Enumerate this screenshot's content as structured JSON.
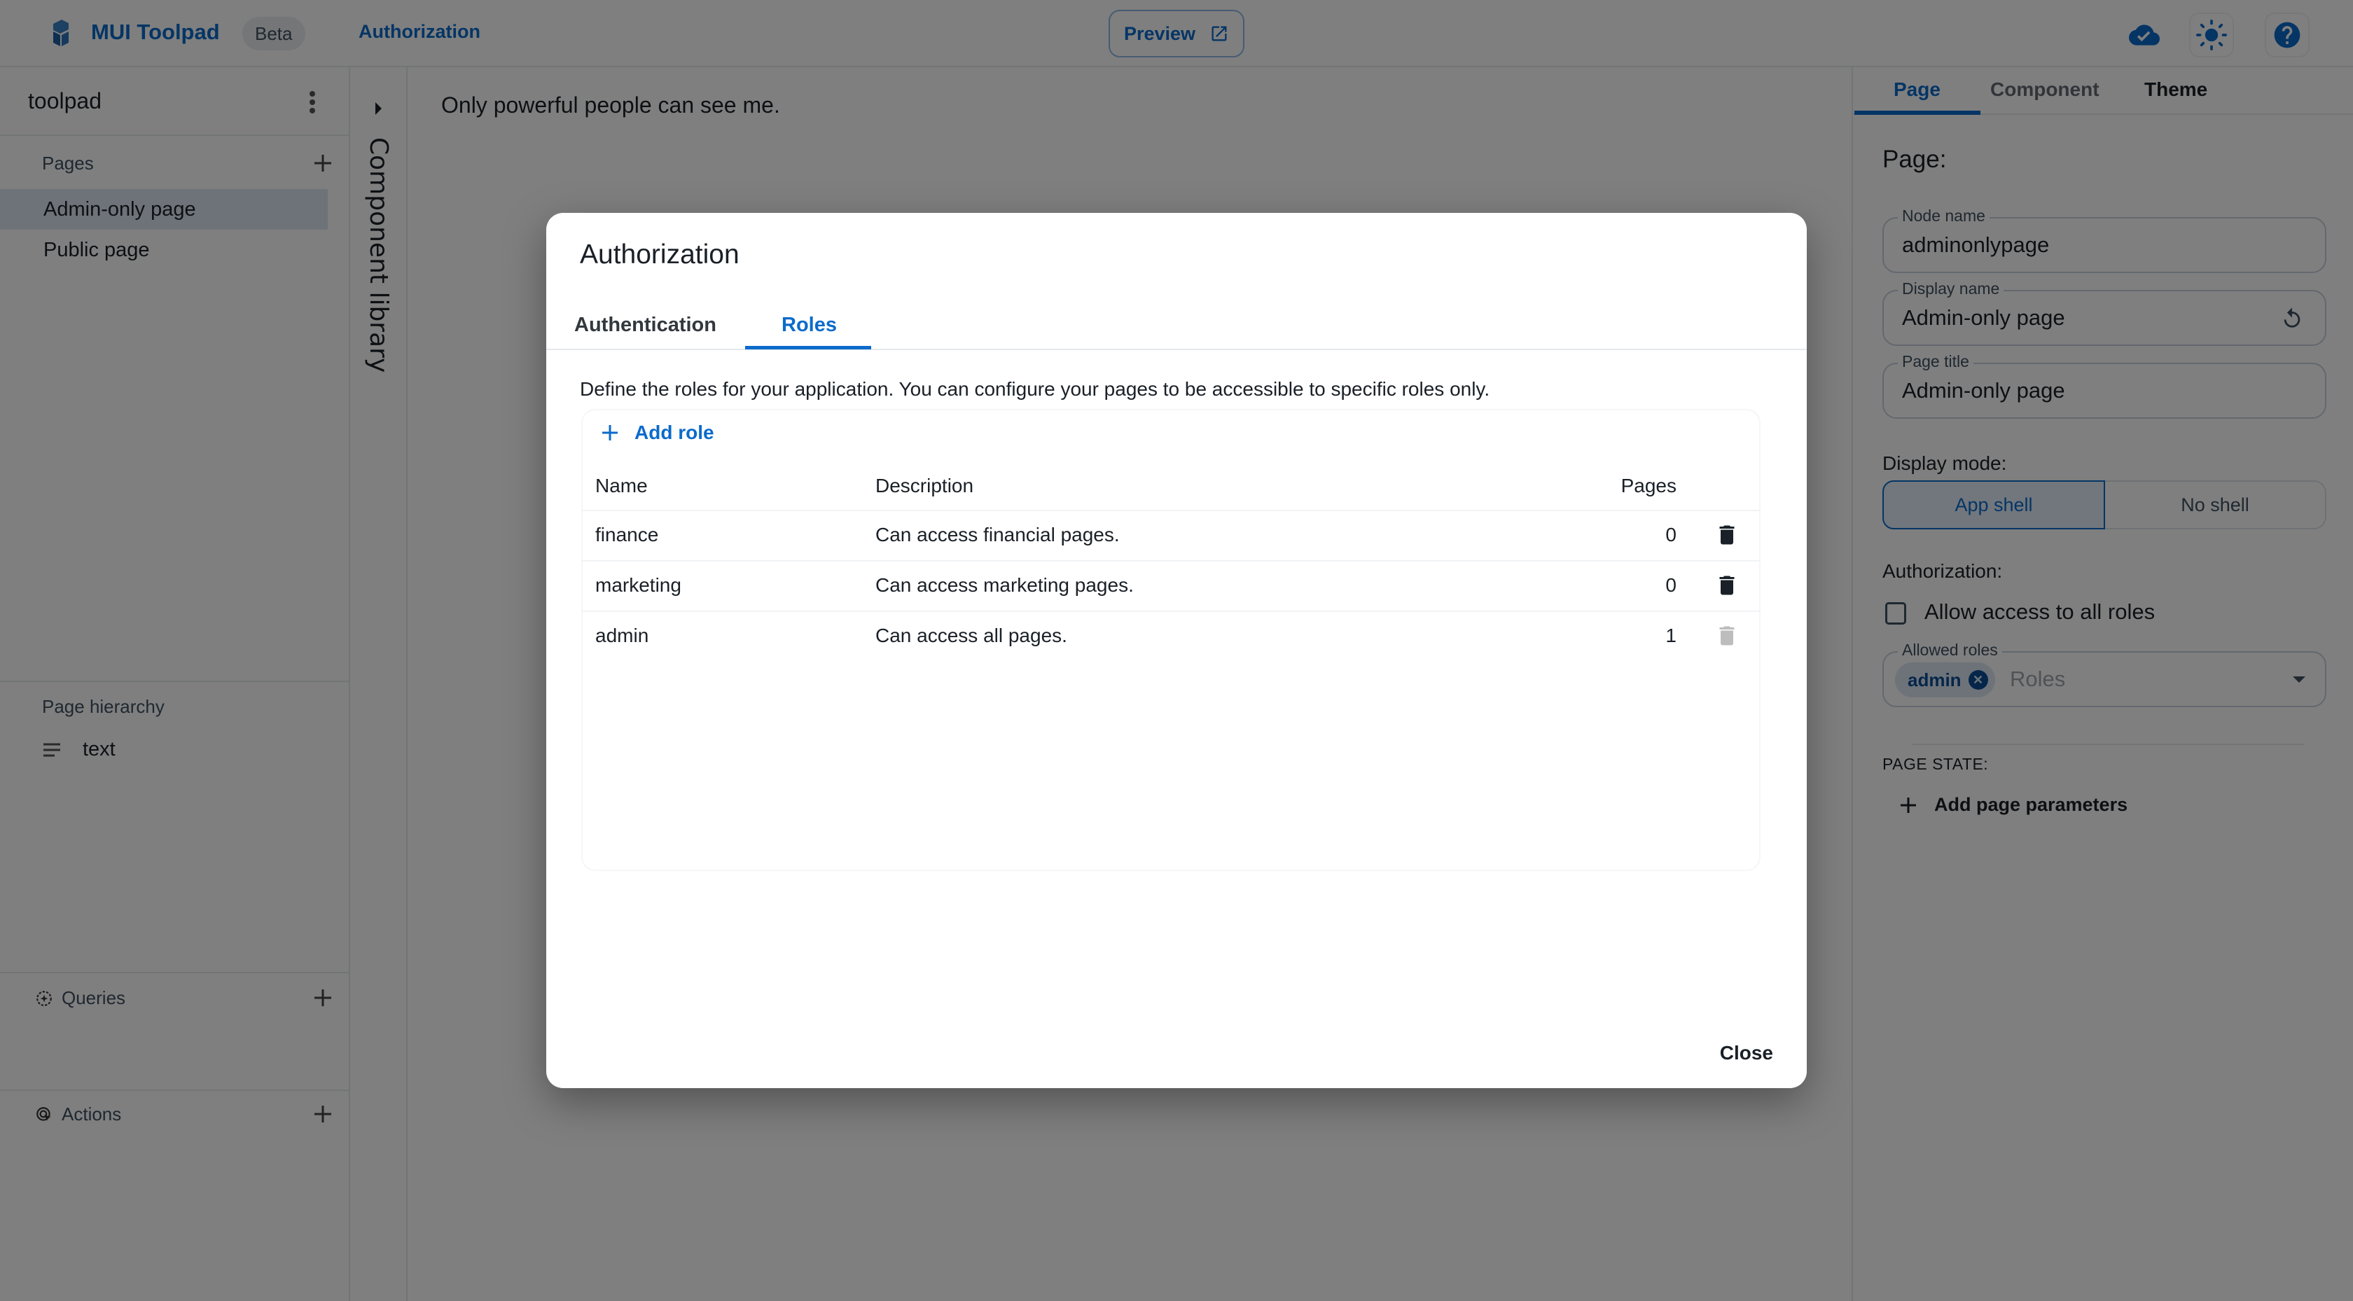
{
  "colors": {
    "primary": "#0b6bcb",
    "text": "#1a2027",
    "disabled": "#bdbdbd",
    "selected_bg": "#dde7f3"
  },
  "topbar": {
    "brand": "MUI Toolpad",
    "badge": "Beta",
    "breadcrumb": "Authorization",
    "preview_label": "Preview",
    "icons": [
      "cloud-done-icon",
      "light-mode-icon",
      "help-icon"
    ]
  },
  "left_panel": {
    "project_name": "toolpad",
    "pages_label": "Pages",
    "pages": [
      {
        "label": "Admin-only page",
        "selected": true
      },
      {
        "label": "Public page",
        "selected": false
      }
    ],
    "hierarchy_label": "Page hierarchy",
    "hierarchy_items": [
      {
        "label": "text",
        "icon": "notes-icon"
      }
    ],
    "queries_label": "Queries",
    "actions_label": "Actions"
  },
  "component_library": {
    "label": "Component library"
  },
  "canvas": {
    "text": "Only powerful people can see me."
  },
  "right_panel": {
    "tabs": [
      {
        "label": "Page",
        "active": true
      },
      {
        "label": "Component",
        "active": false
      },
      {
        "label": "Theme",
        "active": false
      }
    ],
    "title": "Page:",
    "node_name": {
      "label": "Node name",
      "value": "adminonlypage"
    },
    "display_name": {
      "label": "Display name",
      "value": "Admin-only page"
    },
    "page_title": {
      "label": "Page title",
      "value": "Admin-only page"
    },
    "display_mode_label": "Display mode:",
    "display_mode_options": [
      {
        "label": "App shell",
        "active": true
      },
      {
        "label": "No shell",
        "active": false
      }
    ],
    "authorization_label": "Authorization:",
    "allow_all_label": "Allow access to all roles",
    "allow_all_checked": false,
    "allowed_roles": {
      "label": "Allowed roles",
      "placeholder": "Roles",
      "chips": [
        "admin"
      ]
    },
    "page_state_label": "PAGE STATE:",
    "add_params_label": "Add page parameters"
  },
  "dialog": {
    "title": "Authorization",
    "tabs": [
      {
        "label": "Authentication",
        "active": false
      },
      {
        "label": "Roles",
        "active": true
      }
    ],
    "description": "Define the roles for your application. You can configure your pages to be accessible to specific roles only.",
    "add_role_label": "Add role",
    "columns": [
      "Name",
      "Description",
      "Pages"
    ],
    "rows": [
      {
        "name": "finance",
        "description": "Can access financial pages.",
        "pages": "0",
        "delete_enabled": true
      },
      {
        "name": "marketing",
        "description": "Can access marketing pages.",
        "pages": "0",
        "delete_enabled": true
      },
      {
        "name": "admin",
        "description": "Can access all pages.",
        "pages": "1",
        "delete_enabled": false
      }
    ],
    "close_label": "Close"
  }
}
